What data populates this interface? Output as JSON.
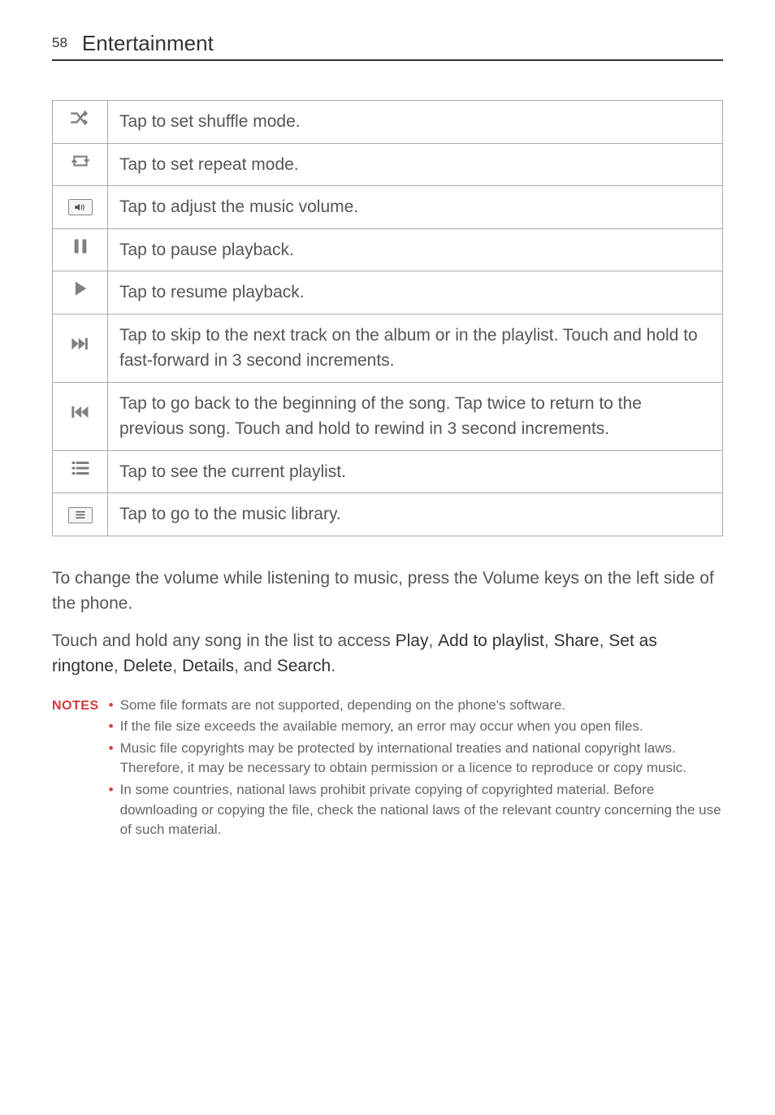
{
  "header": {
    "page_number": "58",
    "section": "Entertainment"
  },
  "table_rows": [
    {
      "icon": "shuffle-icon",
      "desc": "Tap to set shuffle mode."
    },
    {
      "icon": "repeat-icon",
      "desc": "Tap to set repeat mode."
    },
    {
      "icon": "volume-icon",
      "desc": "Tap to adjust the music volume."
    },
    {
      "icon": "pause-icon",
      "desc": "Tap to pause playback."
    },
    {
      "icon": "play-icon",
      "desc": "Tap to resume playback."
    },
    {
      "icon": "next-track-icon",
      "desc": "Tap to skip to the next track on the album or in the playlist. Touch and hold to fast-forward in 3 second increments."
    },
    {
      "icon": "prev-track-icon",
      "desc": "Tap to go back to the beginning of the song. Tap twice to return to the previous song. Touch and hold to rewind in 3 second increments."
    },
    {
      "icon": "playlist-icon",
      "desc": "Tap to see the current playlist."
    },
    {
      "icon": "library-icon",
      "desc": "Tap to go to the music library."
    }
  ],
  "paragraphs": {
    "p1": "To change the volume while listening to music, press the Volume keys on the left side of the phone.",
    "p2_prefix": "Touch and hold any song in the list to access ",
    "p2_items": [
      "Play",
      "Add to playlist",
      "Share",
      "Set as ringtone",
      "Delete",
      "Details",
      "Search"
    ],
    "p2_sep": ", ",
    "p2_last_sep": ", and ",
    "p2_suffix": "."
  },
  "notes": {
    "label": "NOTES",
    "items": [
      "Some file formats are not supported, depending on the phone's software.",
      "If the file size exceeds the available memory, an error may occur when you open files.",
      "Music file copyrights may be protected by international treaties and national copyright laws. Therefore, it may be necessary to obtain permission or a licence to reproduce or copy music.",
      "In some countries, national laws prohibit private copying of copyrighted material. Before downloading or copying the file, check the national laws of the relevant country concerning the use of such material."
    ]
  }
}
